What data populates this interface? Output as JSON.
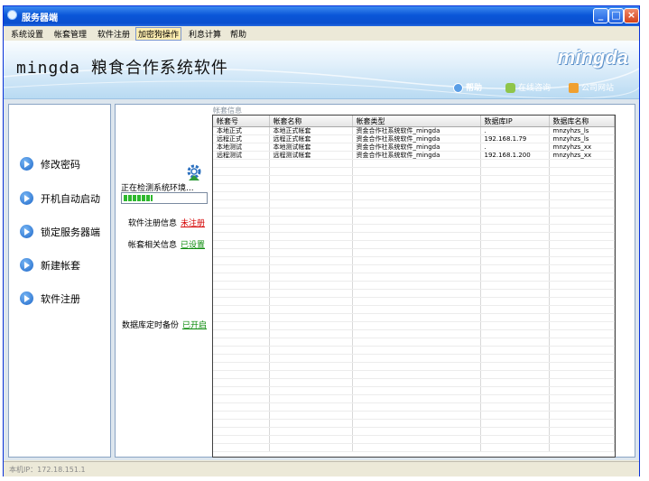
{
  "window": {
    "title": "服务器端"
  },
  "menu": {
    "items": [
      "系统设置",
      "帐套管理",
      "软件注册",
      "加密狗操作",
      "利息计算",
      "帮助"
    ],
    "active": "加密狗操作"
  },
  "banner": {
    "title": "mingda 粮食合作系统软件",
    "brand": "mingda",
    "links": {
      "help": "帮助",
      "consult": "在线咨询",
      "website": "公司网站"
    }
  },
  "sidebar": {
    "items": [
      {
        "label": "修改密码",
        "icon": "arrow-right-icon"
      },
      {
        "label": "开机自动启动",
        "icon": "arrow-right-icon"
      },
      {
        "label": "锁定服务器端",
        "icon": "arrow-right-icon"
      },
      {
        "label": "新建帐套",
        "icon": "arrow-right-icon"
      },
      {
        "label": "软件注册",
        "icon": "arrow-right-icon"
      }
    ]
  },
  "status_panel": {
    "check_label": "正在检测系统环境...",
    "progress": 0.35,
    "reg_label": "软件注册信息",
    "reg_value": "未注册",
    "account_label": "帐套相关信息",
    "account_value": "已设置",
    "backup_label": "数据库定时备份",
    "backup_value": "已开启"
  },
  "accounts": {
    "section_label": "帐套信息",
    "columns": [
      "帐套号",
      "帐套名称",
      "帐套类型",
      "数据库IP",
      "数据库名称"
    ],
    "rows": [
      [
        "本地正式",
        "本地正式帐套",
        "资金合作社系统软件_mingda",
        ".",
        "mnzyhzs_ls"
      ],
      [
        "远程正式",
        "远程正式帐套",
        "资金合作社系统软件_mingda",
        "192.168.1.79",
        "mnzyhzs_ls"
      ],
      [
        "本地测试",
        "本地测试帐套",
        "资金合作社系统软件_mingda",
        ".",
        "mnzyhzs_xx"
      ],
      [
        "远程测试",
        "远程测试帐套",
        "资金合作社系统软件_mingda",
        "192.168.1.200",
        "mnzyhzs_xx"
      ]
    ]
  },
  "statusbar": {
    "text": "本机IP：172.18.151.1"
  },
  "colors": {
    "titlebar": "#0a56d8",
    "red": "#d40000",
    "green": "#0a8a0a",
    "banner": "#b8daf2"
  }
}
